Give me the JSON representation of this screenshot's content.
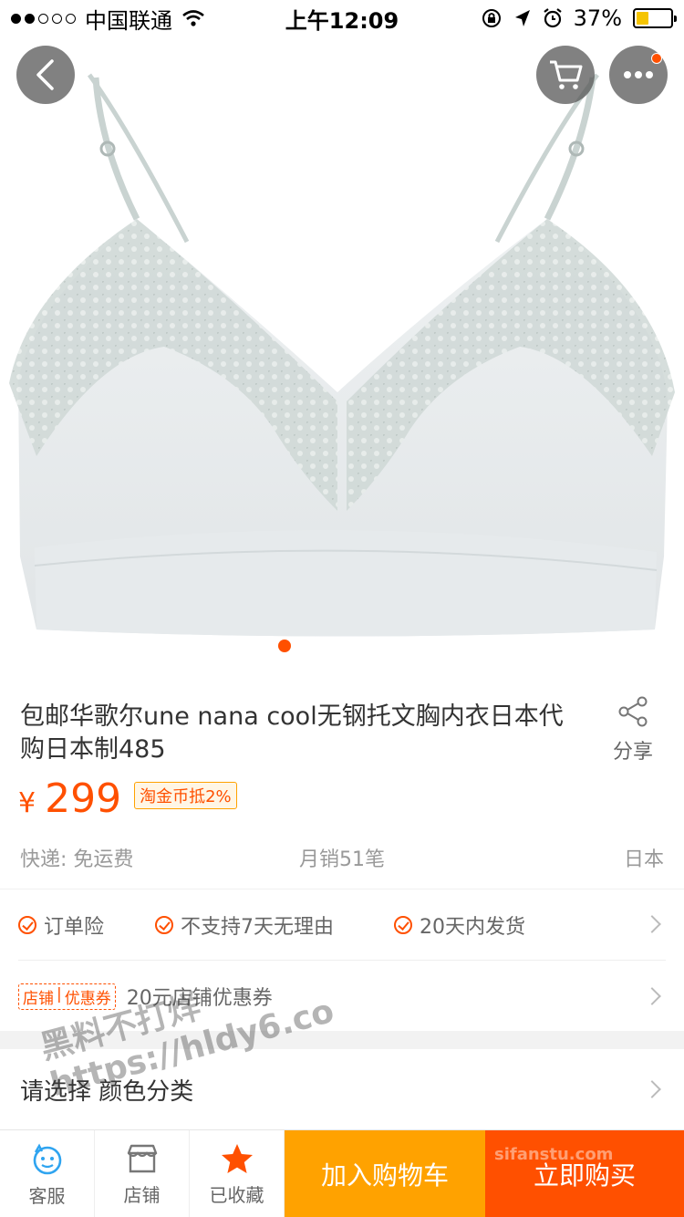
{
  "status_bar": {
    "carrier": "中国联通",
    "time": "上午12:09",
    "battery": "37%",
    "battery_level": 0.37
  },
  "product": {
    "image": "bra-product-photo",
    "title": "包邮华歌尔une nana cool无钢托文胸内衣日本代购日本制485",
    "share_label": "分享",
    "currency": "¥",
    "price": "299",
    "coin_badge": "淘金币抵2%",
    "shipping": "快递: 免运费",
    "monthly_sales": "月销51笔",
    "origin": "日本"
  },
  "services": {
    "items": [
      "订单险",
      "不支持7天无理由",
      "20天内发货"
    ],
    "coupon_badge_left": "店铺",
    "coupon_badge_right": "优惠券",
    "coupon_text": "20元店铺优惠券"
  },
  "sku": {
    "label": "请选择 颜色分类"
  },
  "watermark": {
    "line1": "黑料不打烊",
    "line2": "https://hldy6.co",
    "line3": "sifanstu.com"
  },
  "bottom_bar": {
    "service": "客服",
    "shop": "店铺",
    "favorited": "已收藏",
    "add_to_cart": "加入购物车",
    "buy_now": "立即购买"
  },
  "colors": {
    "accent": "#ff5000",
    "cart": "#ffa200"
  }
}
